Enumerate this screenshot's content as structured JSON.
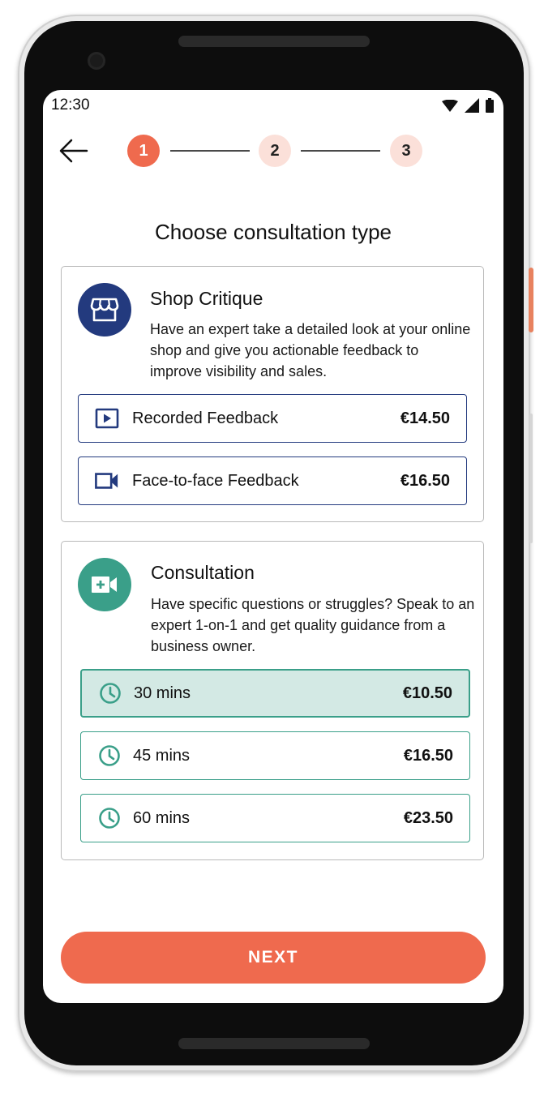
{
  "status_bar": {
    "time": "12:30"
  },
  "stepper": {
    "steps": [
      "1",
      "2",
      "3"
    ],
    "active_step": 1
  },
  "page": {
    "title": "Choose consultation type"
  },
  "shop_critique": {
    "title": "Shop Critique",
    "description": "Have an expert take a detailed look at your online shop and give you actionable feedback to improve visibility and sales.",
    "icon": "storefront-icon",
    "accent_color": "#233a7e",
    "options": [
      {
        "label": "Recorded Feedback",
        "price": "€14.50",
        "icon": "play-video-icon"
      },
      {
        "label": "Face-to-face Feedback",
        "price": "€16.50",
        "icon": "video-camera-icon"
      }
    ]
  },
  "consultation": {
    "title": "Consultation",
    "description": "Have specific questions or struggles? Speak to an expert 1-on-1 and get quality guidance from a business owner.",
    "icon": "video-call-icon",
    "accent_color": "#3a9f89",
    "options": [
      {
        "label": "30 mins",
        "price": "€10.50",
        "icon": "clock-icon",
        "selected": true
      },
      {
        "label": "45 mins",
        "price": "€16.50",
        "icon": "clock-icon",
        "selected": false
      },
      {
        "label": "60 mins",
        "price": "€23.50",
        "icon": "clock-icon",
        "selected": false
      }
    ]
  },
  "footer": {
    "next_label": "NEXT",
    "button_color": "#ef6a4e"
  }
}
